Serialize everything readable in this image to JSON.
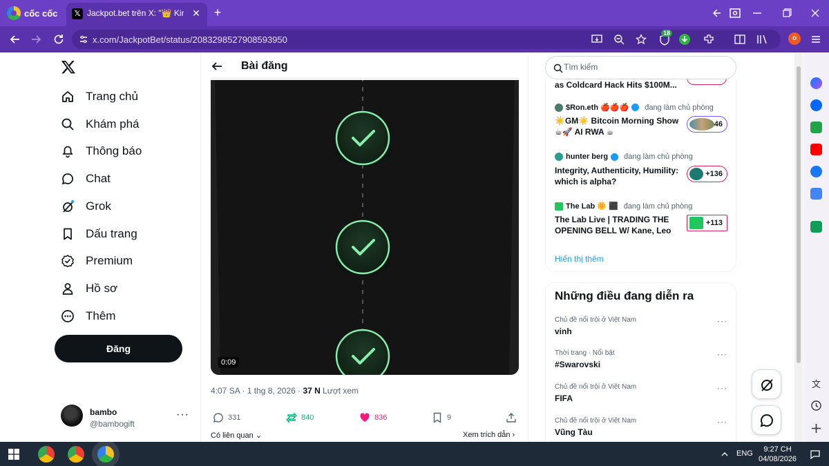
{
  "browser": {
    "brand": "cốc cốc",
    "tab_title": "Jackpot.bet trên X: \"👑 Kings",
    "url": "x.com/JackpotBet/status/2083298527908593950",
    "extension_badge": "18",
    "profile_initial": "o"
  },
  "nav": {
    "items": [
      {
        "label": "Trang chủ",
        "icon": "home-icon"
      },
      {
        "label": "Khám phá",
        "icon": "search-icon"
      },
      {
        "label": "Thông báo",
        "icon": "bell-icon"
      },
      {
        "label": "Chat",
        "icon": "chat-icon"
      },
      {
        "label": "Grok",
        "icon": "grok-icon"
      },
      {
        "label": "Dấu trang",
        "icon": "bookmark-icon"
      },
      {
        "label": "Premium",
        "icon": "premium-icon"
      },
      {
        "label": "Hồ sơ",
        "icon": "profile-icon"
      },
      {
        "label": "Thêm",
        "icon": "more-icon"
      }
    ],
    "post_button": "Đăng"
  },
  "account": {
    "name": "bambo",
    "handle": "@bambogift",
    "more": "···"
  },
  "post": {
    "header_title": "Bài đăng",
    "video_time": "0:09",
    "timestamp": "4:07 SA · 1 thg 8, 2026 · ",
    "views_count": "37 N",
    "views_label": " Lượt xem",
    "replies": "331",
    "reposts": "840",
    "likes": "836",
    "bookmarks": "9",
    "related_label": "Có liên quan",
    "view_quotes_label": "Xem trích dẫn"
  },
  "search": {
    "placeholder": "Tìm kiếm"
  },
  "spaces": {
    "partial_title": "as Coldcard Hack Hits $100M...",
    "items": [
      {
        "host": "$Ron.eth 🍎🍎🍎",
        "status": "đang làm chủ phòng",
        "title": "☀️GM☀️ Bitcoin Morning Show ☕🚀 AI RWA ☕",
        "count": "+146"
      },
      {
        "host": "hunter berg",
        "status": "đang làm chủ phòng",
        "title": "Integrity, Authenticity, Humility: which is alpha?",
        "count": "+136"
      },
      {
        "host": "The Lab 🌼 ⬛",
        "status": "đang làm chủ phòng",
        "title": "The Lab Live | TRADING THE OPENING BELL W/ Kane, Leo",
        "count": "+113"
      }
    ],
    "show_more": "Hiển thị thêm"
  },
  "trends": {
    "title": "Những điều đang diễn ra",
    "items": [
      {
        "context": "Chủ đề nổi trội ở Việt Nam",
        "name": "vinh"
      },
      {
        "context": "Thời trang · Nổi bật",
        "name": "#Swarovski"
      },
      {
        "context": "Chủ đề nổi trội ở Việt Nam",
        "name": "FIFA"
      },
      {
        "context": "Chủ đề nổi trội ở Việt Nam",
        "name": "Vũng Tàu"
      }
    ],
    "more": "···"
  },
  "taskbar": {
    "lang": "ENG",
    "time": "9:27 CH",
    "date": "04/08/2026"
  },
  "colors": {
    "browser_purple": "#6c40c4",
    "check_green": "#4ade80",
    "repost_green": "#00ba7c",
    "like_pink": "#f91880",
    "link_blue": "#1d9bf0"
  }
}
